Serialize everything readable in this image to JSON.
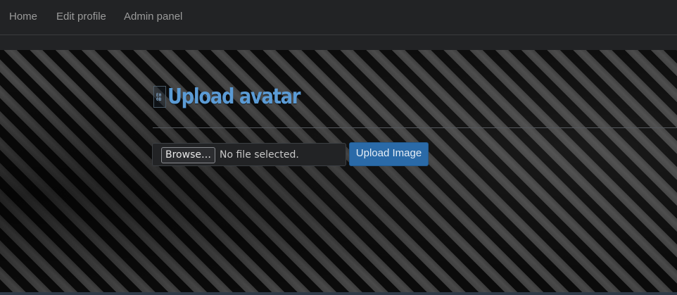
{
  "nav": {
    "items": [
      {
        "label": "Home"
      },
      {
        "label": "Edit profile"
      },
      {
        "label": "Admin panel"
      }
    ]
  },
  "page": {
    "title": "Upload avatar",
    "broken_image_glyph": [
      "E0",
      "0B"
    ]
  },
  "form": {
    "browse_label": "Browse…",
    "file_status": "No file selected.",
    "submit_label": "Upload Image"
  },
  "colors": {
    "navbar_bg": "#222325",
    "title_color": "#5b9bd5",
    "primary_button": "#2a6aa8"
  },
  "icons": {
    "broken_image": "broken-image-icon"
  }
}
